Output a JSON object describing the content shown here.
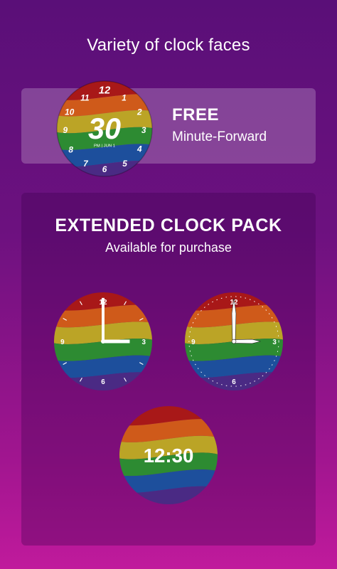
{
  "header": {
    "title": "Variety of clock faces"
  },
  "free_card": {
    "label": "FREE",
    "subtitle": "Minute-Forward",
    "clock": {
      "big_minutes": "30",
      "small_info": "PM | JUN 1",
      "numerals": [
        "12",
        "1",
        "2",
        "3",
        "4",
        "5",
        "6",
        "7",
        "8",
        "9",
        "10",
        "11"
      ]
    }
  },
  "extended_card": {
    "title": "EXTENDED CLOCK PACK",
    "subtitle": "Available for purchase",
    "analog_numerals": [
      "12",
      "3",
      "6",
      "9"
    ],
    "digital_time": "12:30"
  },
  "colors": {
    "rainbow": [
      "#a81818",
      "#cf5a1a",
      "#bba426",
      "#2d8b32",
      "#1d4f9c",
      "#4a2a84"
    ],
    "background_top": "#5a0f78",
    "background_bottom": "#c01a9c"
  }
}
